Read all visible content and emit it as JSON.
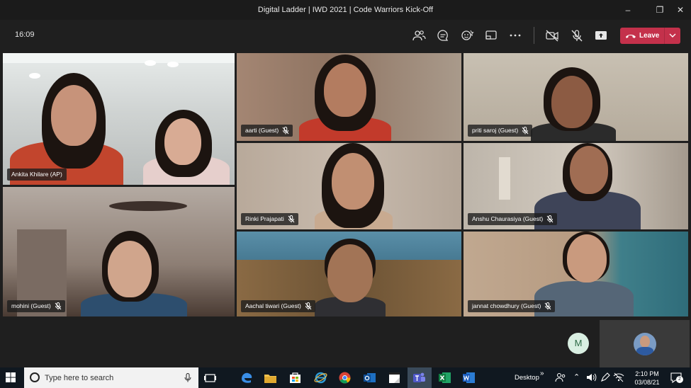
{
  "window": {
    "title": "Digital Ladder | IWD 2021 | Code Warriors Kick-Off",
    "buttons": [
      "minimize-icon",
      "maximize-icon",
      "close-icon"
    ]
  },
  "callbar": {
    "timer": "16:09",
    "icons": [
      "participants-icon",
      "chat-icon",
      "reactions-icon",
      "share-tray-icon",
      "more-options-icon",
      "camera-off-icon",
      "mic-off-icon",
      "share-content-icon"
    ],
    "leave_label": "Leave",
    "leave_color": "#c4314b"
  },
  "participants": [
    {
      "name": "Ankita Khilare (AP)",
      "muted": false
    },
    {
      "name": "aarti (Guest)",
      "muted": true
    },
    {
      "name": "priti saroj (Guest)",
      "muted": true
    },
    {
      "name": "Rinki Prajapati",
      "muted": true
    },
    {
      "name": "Anshu Chaurasiya (Guest)",
      "muted": true
    },
    {
      "name": "mohini (Guest)",
      "muted": true
    },
    {
      "name": "Aachal tiwari (Guest)",
      "muted": true
    },
    {
      "name": "jannat chowdhury (Guest)",
      "muted": true
    }
  ],
  "bottom_strip": {
    "avatar_initial": "M"
  },
  "taskbar": {
    "search_placeholder": "Type here to search",
    "apps": [
      "task-view-icon",
      "edge-icon",
      "file-explorer-icon",
      "store-icon",
      "ie-icon",
      "chrome-icon",
      "outlook-icon",
      "sticky-notes-icon",
      "teams-icon",
      "excel-icon",
      "word-icon"
    ],
    "desktop_label": "Desktop",
    "time": "2:10 PM",
    "date": "03/08/21",
    "notification_count": "2"
  }
}
